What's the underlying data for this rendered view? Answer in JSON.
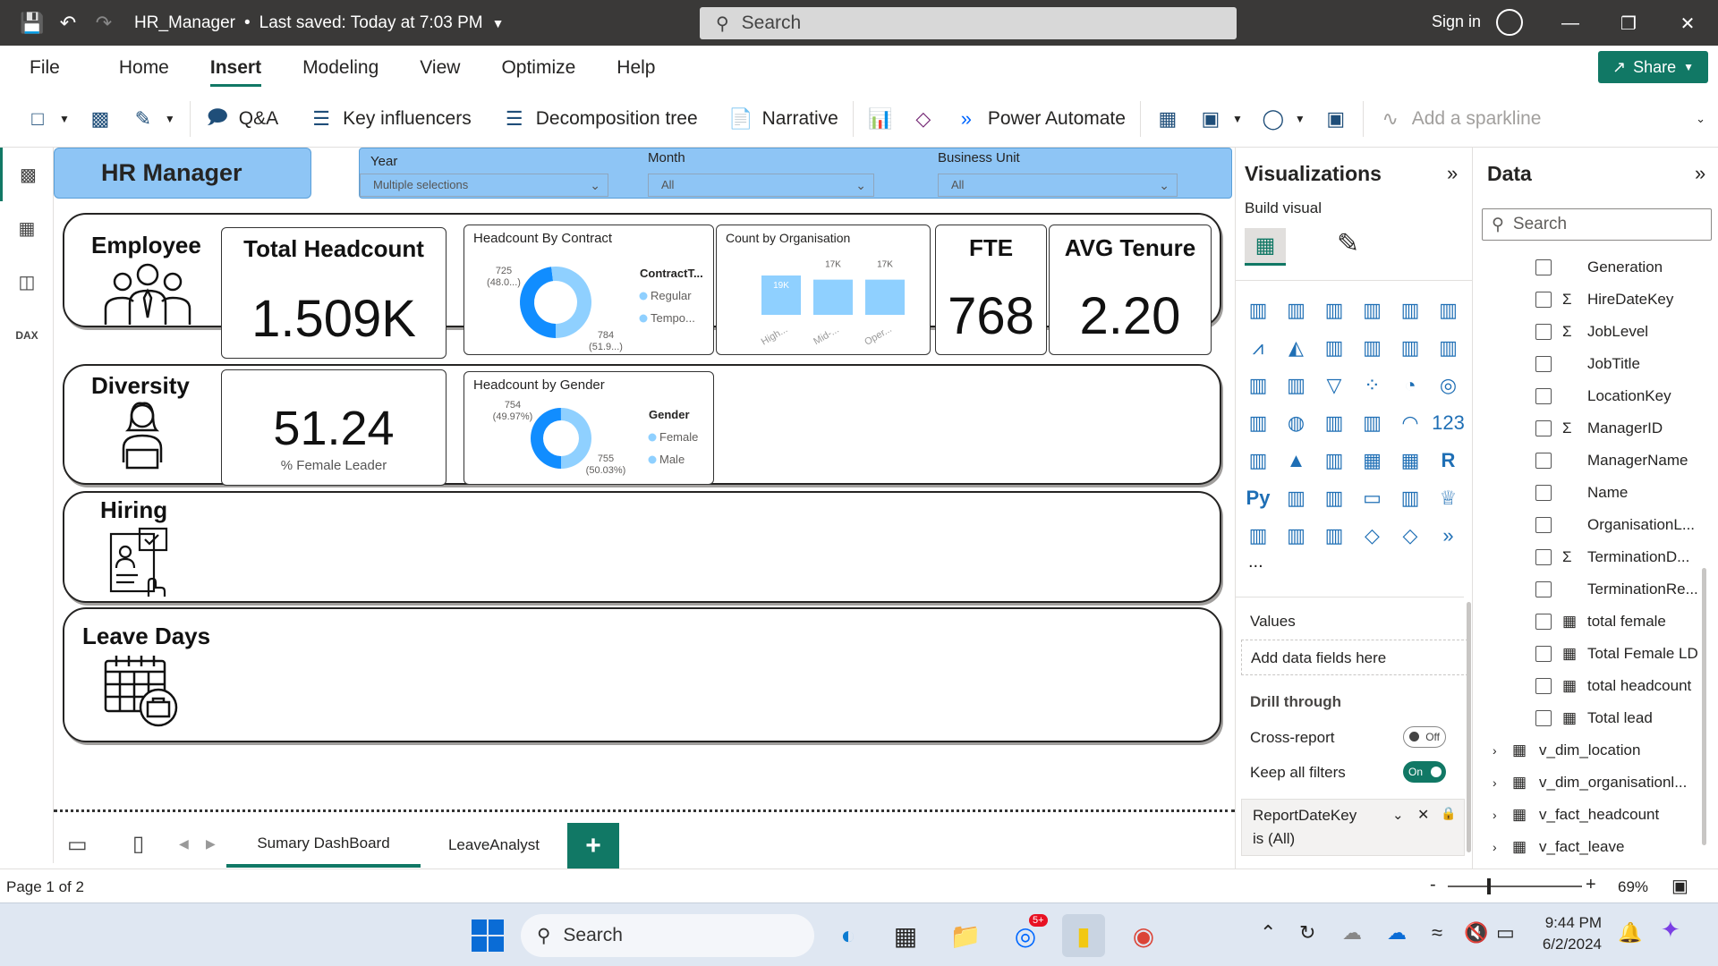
{
  "titlebar": {
    "doc_title": "HR_Manager",
    "saved_text": "Last saved: Today at 7:03 PM",
    "search_placeholder": "Search",
    "sign_in": "Sign in"
  },
  "menu": {
    "items": [
      "File",
      "Home",
      "Insert",
      "Modeling",
      "View",
      "Optimize",
      "Help"
    ],
    "active": "Insert",
    "share_label": "Share"
  },
  "ribbon": {
    "qna": "Q&A",
    "key_influencers": "Key influencers",
    "decomposition_tree": "Decomposition tree",
    "narrative": "Narrative",
    "power_automate": "Power Automate",
    "add_sparkline": "Add a sparkline"
  },
  "report": {
    "title": "HR Manager",
    "slicers": [
      {
        "label": "Year",
        "value": "Multiple selections"
      },
      {
        "label": "Month",
        "value": "All"
      },
      {
        "label": "Business Unit",
        "value": "All"
      }
    ],
    "sections": {
      "employee": "Employee",
      "diversity": "Diversity",
      "hiring": "Hiring",
      "leave_days": "Leave Days"
    },
    "cards": {
      "total_headcount": {
        "title": "Total Headcount",
        "value": "1.509K"
      },
      "fte": {
        "title": "FTE",
        "value": "768"
      },
      "avg_tenure": {
        "title": "AVG Tenure",
        "value": "2.20"
      },
      "female_leader": {
        "value": "51.24",
        "label": "% Female Leader"
      }
    }
  },
  "chart_data": [
    {
      "type": "pie",
      "title": "Headcount By Contract",
      "legend_title": "ContractT...",
      "legend_position": "right",
      "categories": [
        "Regular",
        "Tempo..."
      ],
      "values": [
        725,
        784
      ],
      "data_labels": [
        "725 (48.0...)",
        "784 (51.9...)"
      ],
      "colors": [
        "#118dff",
        "#8fd0ff"
      ]
    },
    {
      "type": "bar",
      "title": "Count by Organisation",
      "categories": [
        "High...",
        "Mid-...",
        "Oper..."
      ],
      "values": [
        19,
        17,
        17
      ],
      "data_labels": [
        "19K",
        "17K",
        "17K"
      ],
      "color": "#8fd0ff"
    },
    {
      "type": "pie",
      "title": "Headcount by Gender",
      "legend_title": "Gender",
      "legend_position": "right",
      "categories": [
        "Female",
        "Male"
      ],
      "values": [
        754,
        755
      ],
      "data_labels": [
        "754 (49.97%)",
        "755 (50.03%)"
      ],
      "colors": [
        "#118dff",
        "#8fd0ff"
      ]
    }
  ],
  "page_tabs": {
    "tabs": [
      "Sumary DashBoard",
      "LeaveAnalyst"
    ],
    "active": "Sumary DashBoard"
  },
  "status": {
    "page": "Page 1 of 2",
    "zoom": "69%"
  },
  "viz_pane": {
    "title": "Visualizations",
    "build_visual": "Build visual",
    "values_label": "Values",
    "add_fields": "Add data fields here",
    "drill_through": "Drill through",
    "cross_report": "Cross-report",
    "cross_report_state": "Off",
    "keep_filters": "Keep all filters",
    "keep_filters_state": "On",
    "filter_field": "ReportDateKey",
    "filter_value": "is (All)",
    "more": "..."
  },
  "data_pane": {
    "title": "Data",
    "search_placeholder": "Search",
    "fields": [
      {
        "name": "Generation",
        "sigma": false,
        "calc": false
      },
      {
        "name": "HireDateKey",
        "sigma": true,
        "calc": false
      },
      {
        "name": "JobLevel",
        "sigma": true,
        "calc": false
      },
      {
        "name": "JobTitle",
        "sigma": false,
        "calc": false
      },
      {
        "name": "LocationKey",
        "sigma": false,
        "calc": false
      },
      {
        "name": "ManagerID",
        "sigma": true,
        "calc": false
      },
      {
        "name": "ManagerName",
        "sigma": false,
        "calc": false
      },
      {
        "name": "Name",
        "sigma": false,
        "calc": false
      },
      {
        "name": "OrganisationL...",
        "sigma": false,
        "calc": false
      },
      {
        "name": "TerminationD...",
        "sigma": true,
        "calc": false
      },
      {
        "name": "TerminationRe...",
        "sigma": false,
        "calc": false
      },
      {
        "name": "total female",
        "sigma": false,
        "calc": true
      },
      {
        "name": "Total Female LD",
        "sigma": false,
        "calc": true
      },
      {
        "name": "total headcount",
        "sigma": false,
        "calc": true
      },
      {
        "name": "Total lead",
        "sigma": false,
        "calc": true
      }
    ],
    "tables": [
      "v_dim_location",
      "v_dim_organisationl...",
      "v_fact_headcount",
      "v_fact_leave"
    ]
  },
  "taskbar": {
    "search": "Search",
    "time": "9:44 PM",
    "date": "6/2/2024",
    "badge": "5+"
  }
}
